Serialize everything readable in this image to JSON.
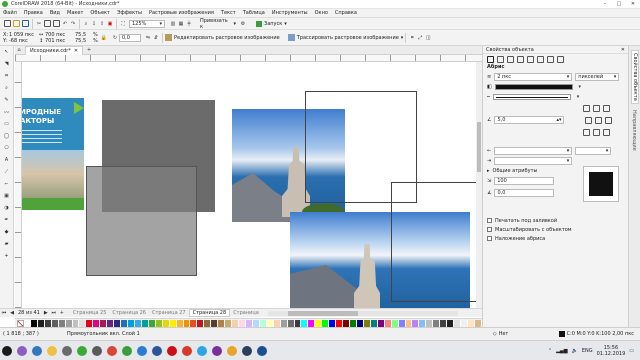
{
  "title_bar": {
    "title": "CorelDRAW 2018 (64-Bit) - Исходники.cdr*"
  },
  "menu": [
    {
      "label": "Файл"
    },
    {
      "label": "Правка"
    },
    {
      "label": "Вид"
    },
    {
      "label": "Макет"
    },
    {
      "label": "Объект"
    },
    {
      "label": "Эффекты"
    },
    {
      "label": "Растровые изображения"
    },
    {
      "label": "Текст"
    },
    {
      "label": "Таблица"
    },
    {
      "label": "Инструменты"
    },
    {
      "label": "Окно"
    },
    {
      "label": "Справка"
    }
  ],
  "toolbar1": {
    "zoom": "125%",
    "snap": "Привязать к",
    "launch": "Запуск"
  },
  "propbar": {
    "x": "1 059 пкс",
    "y": "-68 пкс",
    "w": "700 пкс",
    "h": "701 пкс",
    "sx": "75,5",
    "sy": "75,5",
    "pct": "%",
    "angle": "0,0",
    "edit_bitmap": "Редактировать растровое изображение",
    "trace_bitmap": "Трассировать растровое изображение"
  },
  "doc_tab": {
    "label": "Исходники.cdr*"
  },
  "promo": {
    "line1": "ИРОДНЫЕ",
    "line2": "АКТОРЫ"
  },
  "page_nav": {
    "counter": "28 из 41",
    "pages": [
      {
        "label": "Страница 25"
      },
      {
        "label": "Страница 26"
      },
      {
        "label": "Страница 27"
      },
      {
        "label": "Страница 28"
      },
      {
        "label": "Страница"
      }
    ]
  },
  "docker": {
    "title": "Свойства объекта",
    "side_tabs": [
      {
        "label": "Свойства объекта"
      },
      {
        "label": "Направляющие"
      }
    ],
    "outline_label": "Абрис",
    "width": "2 пкс",
    "units": "пикселей",
    "miter": "5,0",
    "common_attrs": "Общие атрибуты",
    "scale_val": "100",
    "val_zero": "0,0",
    "checks": [
      {
        "label": "Печатать под заливкой"
      },
      {
        "label": "Масштабировать с объектом"
      },
      {
        "label": "Наложение абриса"
      }
    ]
  },
  "status": {
    "coords": "( 1 818 ; 387 )",
    "description": "Прямоугольник вкл. Слой 1",
    "fill_none": "Нет",
    "color_info": "C:0 M:0 Y:0 K:100  2,00 пкс"
  },
  "taskbar": {
    "lang": "ENG",
    "time": "15:56",
    "date": "01.12.2019"
  },
  "palette_colors": [
    "#ffffff",
    "#000000",
    "#1f1f1f",
    "#3f3f3f",
    "#5f5f5f",
    "#7f7f7f",
    "#9f9f9f",
    "#bfbfbf",
    "#dfdfdf",
    "#e2001a",
    "#e6007e",
    "#a3195b",
    "#662483",
    "#312783",
    "#1d71b8",
    "#009fe3",
    "#36a9e1",
    "#00a19a",
    "#3aaa35",
    "#95c11f",
    "#dedc00",
    "#ffed00",
    "#f9b233",
    "#f39200",
    "#e94e1b",
    "#be1622",
    "#8a6d3b",
    "#5b3a29",
    "#b17f4a",
    "#c8a96e",
    "#f5d0a9",
    "#ffd7e8",
    "#d8b5ff",
    "#b5d8ff",
    "#b5ffd8",
    "#ffffb5",
    "#ffcfb5",
    "#9e9e9e",
    "#6d6d6d",
    "#3c3c3c",
    "#00ffff",
    "#ff00ff",
    "#ffff00",
    "#00ff00",
    "#0000ff",
    "#ff0000",
    "#7f0000",
    "#007f00",
    "#00007f",
    "#7f7f00",
    "#007f7f",
    "#7f007f",
    "#ff7f7f",
    "#7fff7f",
    "#7f7fff",
    "#ffbf7f",
    "#bf7fff",
    "#7fbfff",
    "#c0c0c0",
    "#808080",
    "#404040",
    "#202020",
    "#e0e0e0",
    "#f0f0f0",
    "#ffe4c4",
    "#deb887"
  ],
  "taskbar_icons": [
    {
      "name": "start-icon",
      "color": "#1a1a1a"
    },
    {
      "name": "avatar-icon",
      "color": "#8a5fbf"
    },
    {
      "name": "edge-icon",
      "color": "#3277bc"
    },
    {
      "name": "explorer-icon",
      "color": "#f0c040"
    },
    {
      "name": "store-icon",
      "color": "#6a6a6a"
    },
    {
      "name": "app-icon-green",
      "color": "#3aaa35"
    },
    {
      "name": "media-icon",
      "color": "#5a5a5a"
    },
    {
      "name": "chrome-icon",
      "color": "#db4437"
    },
    {
      "name": "coreldraw-icon",
      "color": "#3a9f3a"
    },
    {
      "name": "photos-icon",
      "color": "#2b7cd3"
    },
    {
      "name": "word-icon",
      "color": "#2a5699"
    },
    {
      "name": "opera-icon",
      "color": "#cc0f16"
    },
    {
      "name": "yandex-icon",
      "color": "#d23a2a"
    },
    {
      "name": "telegram-icon",
      "color": "#2ca5e0"
    },
    {
      "name": "vpn-icon",
      "color": "#7b2f9e"
    },
    {
      "name": "notes-icon",
      "color": "#e9a32b"
    },
    {
      "name": "lightroom-icon",
      "color": "#2b3f5e"
    },
    {
      "name": "photoshop-icon",
      "color": "#1b4f91"
    }
  ]
}
